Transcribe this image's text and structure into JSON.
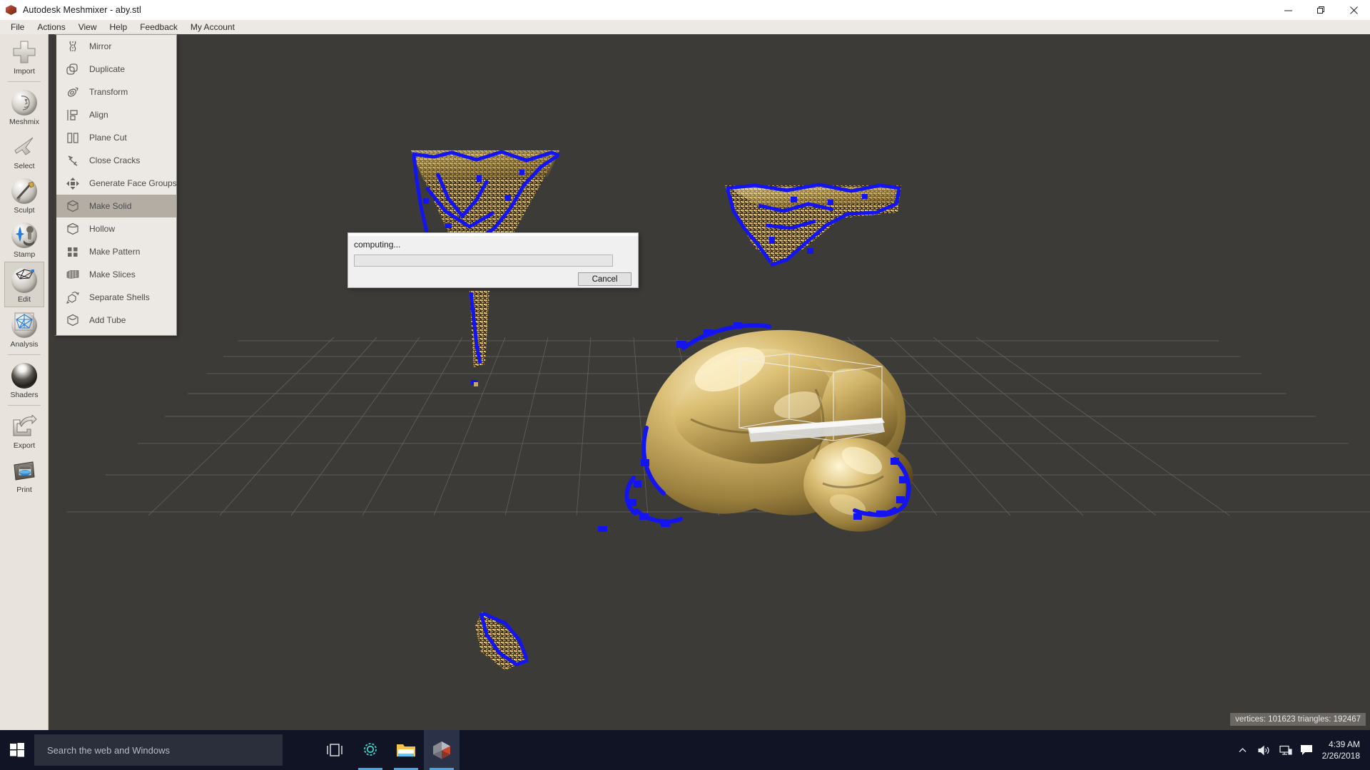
{
  "window": {
    "title": "Autodesk Meshmixer - aby.stl",
    "icon": "meshmixer-hex-icon",
    "controls": {
      "minimize": "minimize-icon",
      "maximize": "restore-icon",
      "close": "close-icon"
    }
  },
  "menubar": {
    "items": [
      {
        "label": "File"
      },
      {
        "label": "Actions"
      },
      {
        "label": "View"
      },
      {
        "label": "Help"
      },
      {
        "label": "Feedback"
      },
      {
        "label": "My Account"
      }
    ]
  },
  "toolrail": {
    "items": [
      {
        "label": "Import",
        "icon": "plus-icon",
        "selected": false
      },
      {
        "label": "Meshmix",
        "icon": "face-sphere-icon",
        "selected": false
      },
      {
        "label": "Select",
        "icon": "cursor-arrow-icon",
        "selected": false
      },
      {
        "label": "Sculpt",
        "icon": "brush-sphere-icon",
        "selected": false
      },
      {
        "label": "Stamp",
        "icon": "stamp-sphere-icon",
        "selected": false
      },
      {
        "label": "Edit",
        "icon": "edit-sphere-icon",
        "selected": true
      },
      {
        "label": "Analysis",
        "icon": "analysis-sphere-icon",
        "selected": false
      },
      {
        "label": "Shaders",
        "icon": "shader-sphere-icon",
        "selected": false
      },
      {
        "label": "Export",
        "icon": "export-arrow-icon",
        "selected": false
      },
      {
        "label": "Print",
        "icon": "printer-icon",
        "selected": false
      }
    ]
  },
  "editmenu": {
    "items": [
      {
        "label": "Mirror",
        "icon": "mirror-icon",
        "active": false
      },
      {
        "label": "Duplicate",
        "icon": "duplicate-icon",
        "active": false
      },
      {
        "label": "Transform",
        "icon": "transform-icon",
        "active": false
      },
      {
        "label": "Align",
        "icon": "align-icon",
        "active": false
      },
      {
        "label": "Plane Cut",
        "icon": "plane-cut-icon",
        "active": false
      },
      {
        "label": "Close Cracks",
        "icon": "close-cracks-icon",
        "active": false
      },
      {
        "label": "Generate Face Groups",
        "icon": "face-groups-icon",
        "active": false
      },
      {
        "label": "Make Solid",
        "icon": "make-solid-icon",
        "active": true
      },
      {
        "label": "Hollow",
        "icon": "hollow-icon",
        "active": false
      },
      {
        "label": "Make Pattern",
        "icon": "make-pattern-icon",
        "active": false
      },
      {
        "label": "Make Slices",
        "icon": "make-slices-icon",
        "active": false
      },
      {
        "label": "Separate Shells",
        "icon": "separate-shells-icon",
        "active": false
      },
      {
        "label": "Add Tube",
        "icon": "add-tube-icon",
        "active": false
      }
    ]
  },
  "dialog": {
    "message": "computing...",
    "progress_percent": 0,
    "cancel_label": "Cancel"
  },
  "viewport": {
    "status": "vertices: 101623 triangles: 192467",
    "background_color": "#3d3b38",
    "grid_color": "#8d8a85",
    "mesh_color": "#c9a85c",
    "boundary_highlight_color": "#1414f0",
    "model_name": "aby.stl"
  },
  "taskbar": {
    "start_icon": "windows-logo-icon",
    "search_placeholder": "Search the web and Windows",
    "items": [
      {
        "icon": "task-view-icon",
        "label": "Task View",
        "active": false,
        "running": false
      },
      {
        "icon": "cortana-icon",
        "label": "Cortana",
        "active": false,
        "running": true
      },
      {
        "icon": "folder-icon",
        "label": "File Explorer",
        "active": false,
        "running": true
      },
      {
        "icon": "meshmixer-icon",
        "label": "Autodesk Meshmixer",
        "active": true,
        "running": true
      }
    ],
    "tray": [
      {
        "icon": "chevron-up-icon",
        "label": "Show hidden icons"
      },
      {
        "icon": "speaker-icon",
        "label": "Volume"
      },
      {
        "icon": "network-icon",
        "label": "Network"
      },
      {
        "icon": "action-center-icon",
        "label": "Action Center"
      }
    ],
    "clock": {
      "time": "4:39 AM",
      "date": "2/26/2018"
    }
  }
}
